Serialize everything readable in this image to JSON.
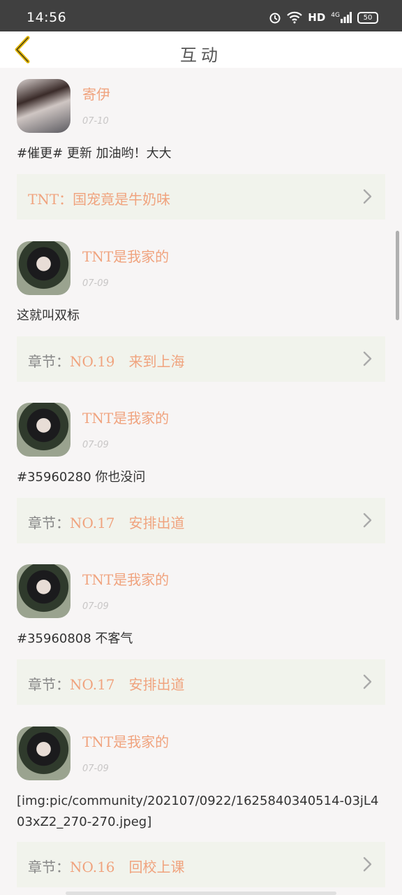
{
  "status": {
    "time": "14:56",
    "network": "HD",
    "signal": "4G",
    "battery": "50"
  },
  "nav": {
    "title": "互动"
  },
  "items": [
    {
      "user": "寄伊",
      "date": "07-10",
      "content": "#催更# 更新 加油哟！大大",
      "link_prefix": "",
      "link": "TNT：国宠竟是牛奶味"
    },
    {
      "user": "TNT是我家的",
      "date": "07-09",
      "content": "这就叫双标",
      "link_prefix": "章节：",
      "link": "NO.19　来到上海"
    },
    {
      "user": "TNT是我家的",
      "date": "07-09",
      "content": "#35960280 你也没问",
      "link_prefix": "章节：",
      "link": "NO.17　安排出道"
    },
    {
      "user": "TNT是我家的",
      "date": "07-09",
      "content": "#35960808 不客气",
      "link_prefix": "章节：",
      "link": "NO.17　安排出道"
    },
    {
      "user": "TNT是我家的",
      "date": "07-09",
      "content": "[img:pic/community/202107/0922/1625840340514-03jL403xZ2_270-270.jpeg]",
      "link_prefix": "章节：",
      "link": "NO.16　回校上课"
    }
  ]
}
